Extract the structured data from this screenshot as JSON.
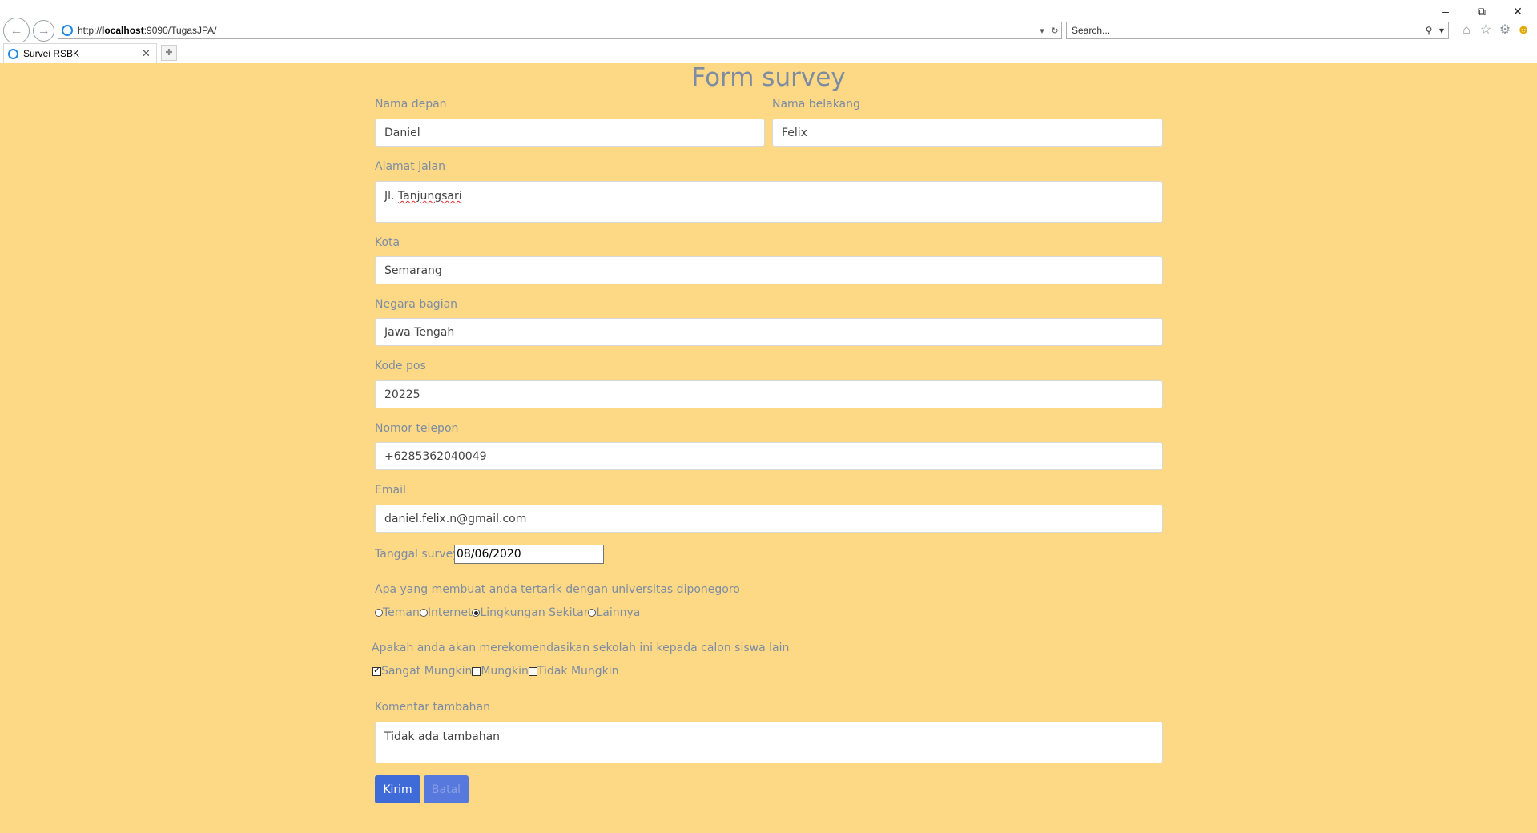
{
  "browser": {
    "url_prefix": "http://",
    "url_host": "localhost",
    "url_rest": ":9090/TugasJPA/",
    "search_placeholder": "Search...",
    "tab_title": "Survei RSBK",
    "icons": [
      "back-icon",
      "forward-icon",
      "ie-icon",
      "dropdown-icon",
      "refresh-icon",
      "search-icon",
      "home-icon",
      "star-icon",
      "gear-icon",
      "smiley-icon",
      "minimize-icon",
      "restore-icon",
      "close-icon",
      "new-tab-icon"
    ]
  },
  "form": {
    "title": "Form survey",
    "first_name": {
      "label": "Nama depan",
      "value": "Daniel"
    },
    "last_name": {
      "label": "Nama belakang",
      "value": "Felix"
    },
    "street": {
      "label": "Alamat jalan",
      "value_prefix": "Jl. ",
      "value_word": "Tanjungsari"
    },
    "city": {
      "label": "Kota",
      "value": "Semarang"
    },
    "state": {
      "label": "Negara bagian",
      "value": "Jawa Tengah"
    },
    "zip": {
      "label": "Kode pos",
      "value": "20225"
    },
    "phone": {
      "label": "Nomor telepon",
      "value": "+6285362040049"
    },
    "email": {
      "label": "Email",
      "value": "daniel.felix.n@gmail.com"
    },
    "survey_date": {
      "label": "Tanggal survey",
      "value": "08/06/2020"
    },
    "interest": {
      "question": "Apa yang membuat anda tertarik dengan universitas diponegoro",
      "options": [
        "Teman",
        "Internet",
        "Lingkungan Sekitar",
        "Lainnya"
      ],
      "selected": "Lingkungan Sekitar"
    },
    "recommend": {
      "question": "Apakah anda akan merekomendasikan sekolah ini kepada calon siswa lain",
      "options": [
        "Sangat Mungkin",
        "Mungkin",
        "Tidak Mungkin"
      ],
      "checked": [
        "Sangat Mungkin"
      ]
    },
    "comment": {
      "label": "Komentar tambahan",
      "value": "Tidak ada tambahan"
    },
    "submit_label": "Kirim",
    "cancel_label": "Batal"
  },
  "colors": {
    "page_bg": "#fed985",
    "label": "#7d8ca3",
    "button": "#3f6bd8"
  }
}
